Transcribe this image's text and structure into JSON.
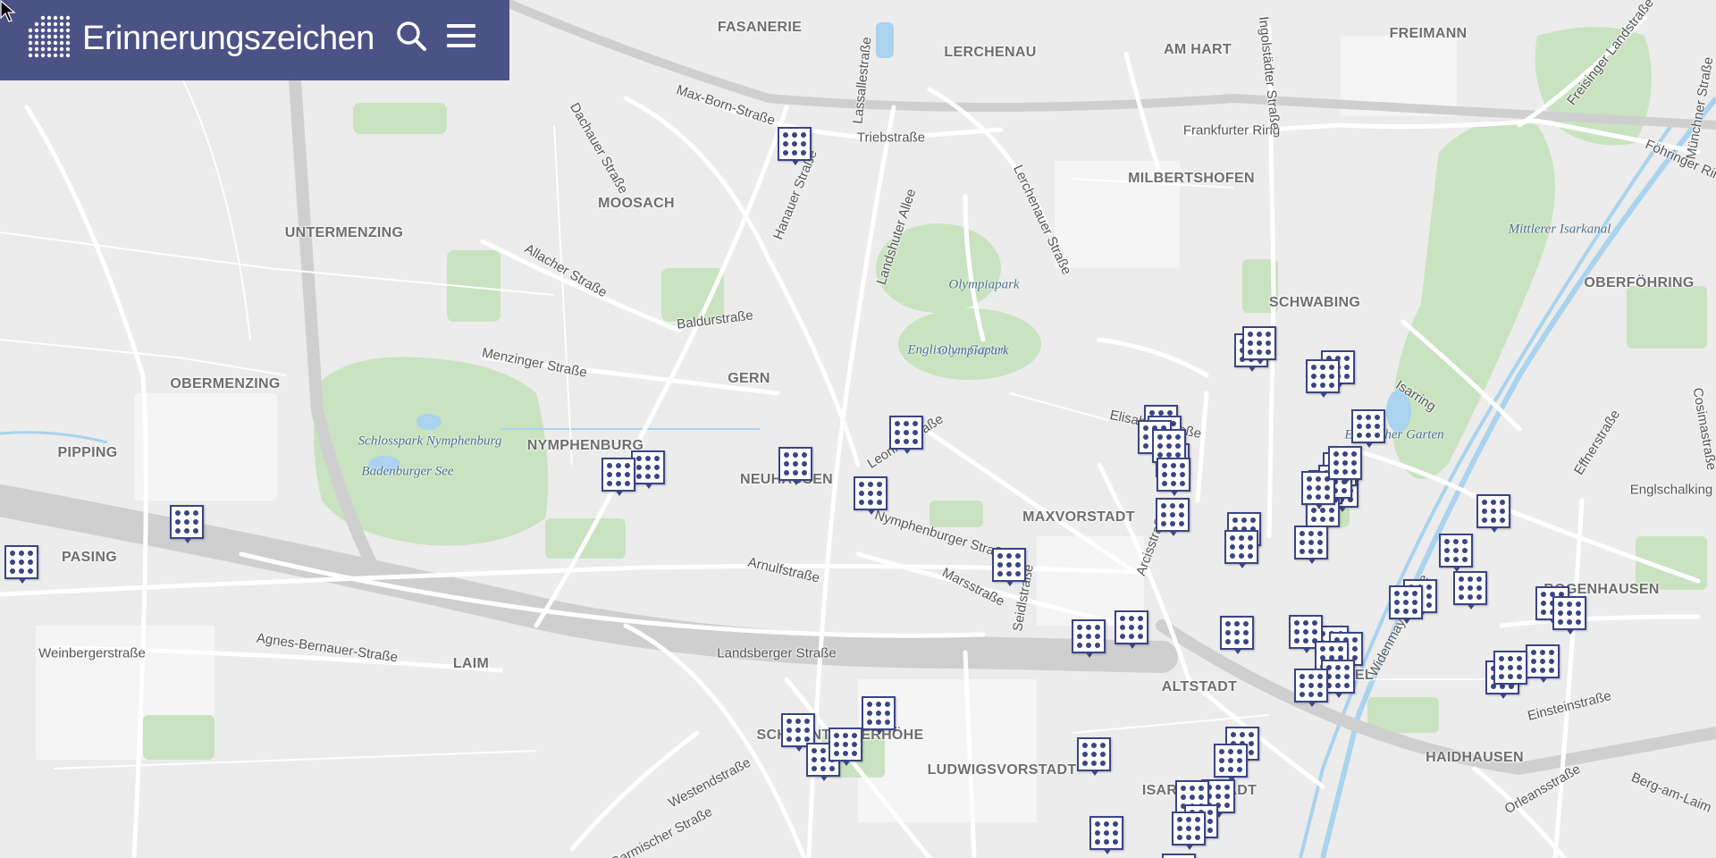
{
  "header": {
    "title": "Erinnerungszeichen",
    "icons": {
      "logo": "dot-grid-logo-icon",
      "search": "search-icon",
      "menu": "hamburger-menu-icon"
    }
  },
  "colors": {
    "header_bg": "#4b5286",
    "marker": "#3a4585",
    "green": "#c9e3c0",
    "water": "#a9d3ee",
    "background": "#ececec"
  },
  "map": {
    "districts": [
      "FASANERIE",
      "LERCHENAU",
      "AM HART",
      "FREIMANN",
      "MOOSACH",
      "MILBERTSHOFEN",
      "UNTERMENZING",
      "SCHWABING",
      "OBERFÖHRING",
      "OBERMENZING",
      "GERN",
      "PIPPING",
      "NYMPHENBURG",
      "NEUHAUSEN",
      "MAXVORSTADT",
      "PASING",
      "LAIM",
      "ALTSTADT",
      "LEHEL",
      "SCHWANTHALERHÖHE",
      "LUDWIGSVORSTADT",
      "ISARVORSTADT",
      "HAIDHAUSEN",
      "BOGENHAUSEN"
    ],
    "streets": [
      "Max-Born-Straße",
      "Triebstraße",
      "Lassallestraße",
      "Dachauer Straße",
      "Hanauer Straße",
      "Landshuter Allee",
      "Lerchenauer Straße",
      "Frankfurter Ring",
      "Ingolstädter Straße",
      "Freisinger Landstraße",
      "Föhringer Ring",
      "Münchner Straße",
      "Allacher Straße",
      "Baldurstraße",
      "Menzinger Straße",
      "Elisabethstraße",
      "Isarring",
      "Effnerstraße",
      "Englschalking",
      "Cosimastraße",
      "Nymphenburger Straße",
      "Arcisstraße",
      "Arnulfstraße",
      "Marsstraße",
      "Seidlstraße",
      "Landsberger Straße",
      "Agnes-Bernauer-Straße",
      "Weinbergerstraße",
      "Widenmayerstraße",
      "Einsteinstraße",
      "Westendstraße",
      "Garmischer Straße",
      "Orleansstraße",
      "Berg-am-Laim",
      "Leonrodstraße"
    ],
    "parks": [
      "Schlosspark Nymphenburg",
      "Badenburger See",
      "Olympiapark",
      "Englischer Garten",
      "Mittlerer Isarkanal"
    ],
    "marker_count": 52
  }
}
